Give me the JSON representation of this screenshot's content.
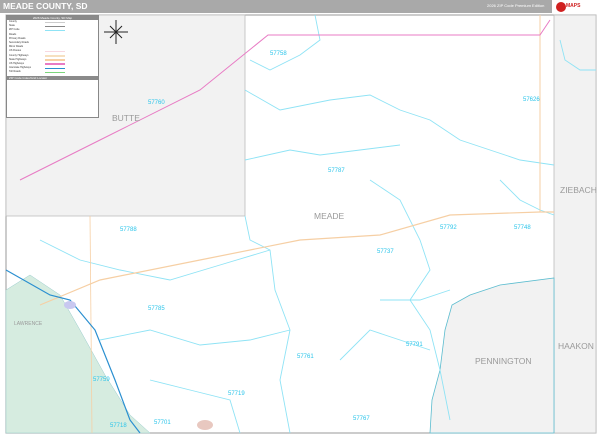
{
  "header": {
    "title": "MEADE COUNTY, SD",
    "edition": "2026 ZIP Code Premium Edition",
    "logo_text": "MAPS"
  },
  "legend": {
    "title": "2026 Meade County, SD Map",
    "items": [
      "County",
      "State",
      "ZIP Code",
      "Roads",
      "Primary Roads",
      "Secondary Roads",
      "Minor Roads",
      "US Routes",
      "County Highways",
      "State Highways",
      "US Highways",
      "Interstate Highways",
      "Toll Roads"
    ],
    "index_title": "ZIP Code Index/Grid Locator"
  },
  "colors": {
    "zip_boundary": "#8fe3f5",
    "county_gray": "#f2f2f2",
    "forest": "#d6ece0",
    "highway": "#f6cfa4",
    "us_route": "#e87bc4",
    "interstate": "#2a8fd0"
  },
  "counties": [
    "BUTTE",
    "MEADE",
    "ZIEBACH",
    "HAAKON",
    "PENNINGTON",
    "LAWRENCE"
  ],
  "zip_labels": [
    "57758",
    "57760",
    "57626",
    "57787",
    "57788",
    "57792",
    "57748",
    "57737",
    "57785",
    "57791",
    "57761",
    "57759",
    "57719",
    "57718",
    "57701",
    "57767"
  ]
}
